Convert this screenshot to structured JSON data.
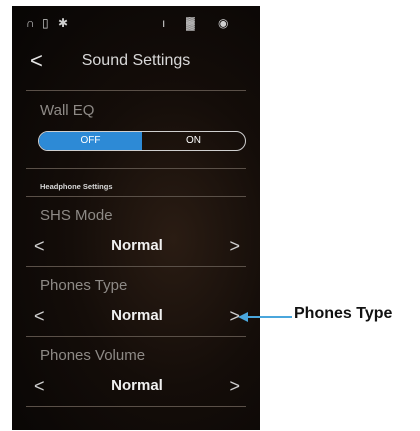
{
  "status_bar": {
    "icons": [
      "headphones-icon",
      "usb-icon",
      "bluetooth-icon",
      "microphone-icon",
      "audio-level-icon",
      "wireless-icon"
    ]
  },
  "header": {
    "back_glyph": "<",
    "title": "Sound Settings"
  },
  "wall_eq": {
    "label": "Wall EQ",
    "options": [
      "OFF",
      "ON"
    ],
    "selected": "OFF"
  },
  "section_label": "Headphone Settings",
  "settings": [
    {
      "label": "SHS Mode",
      "value": "Normal",
      "prev_glyph": "<",
      "next_glyph": ">"
    },
    {
      "label": "Phones Type",
      "value": "Normal",
      "prev_glyph": "<",
      "next_glyph": ">"
    },
    {
      "label": "Phones Volume",
      "value": "Normal",
      "prev_glyph": "<",
      "next_glyph": ">"
    }
  ],
  "callout": {
    "text": "Phones Type"
  },
  "colors": {
    "accent": "#2d8ad6",
    "callout": "#4aa6dc",
    "background": "#140d09"
  }
}
